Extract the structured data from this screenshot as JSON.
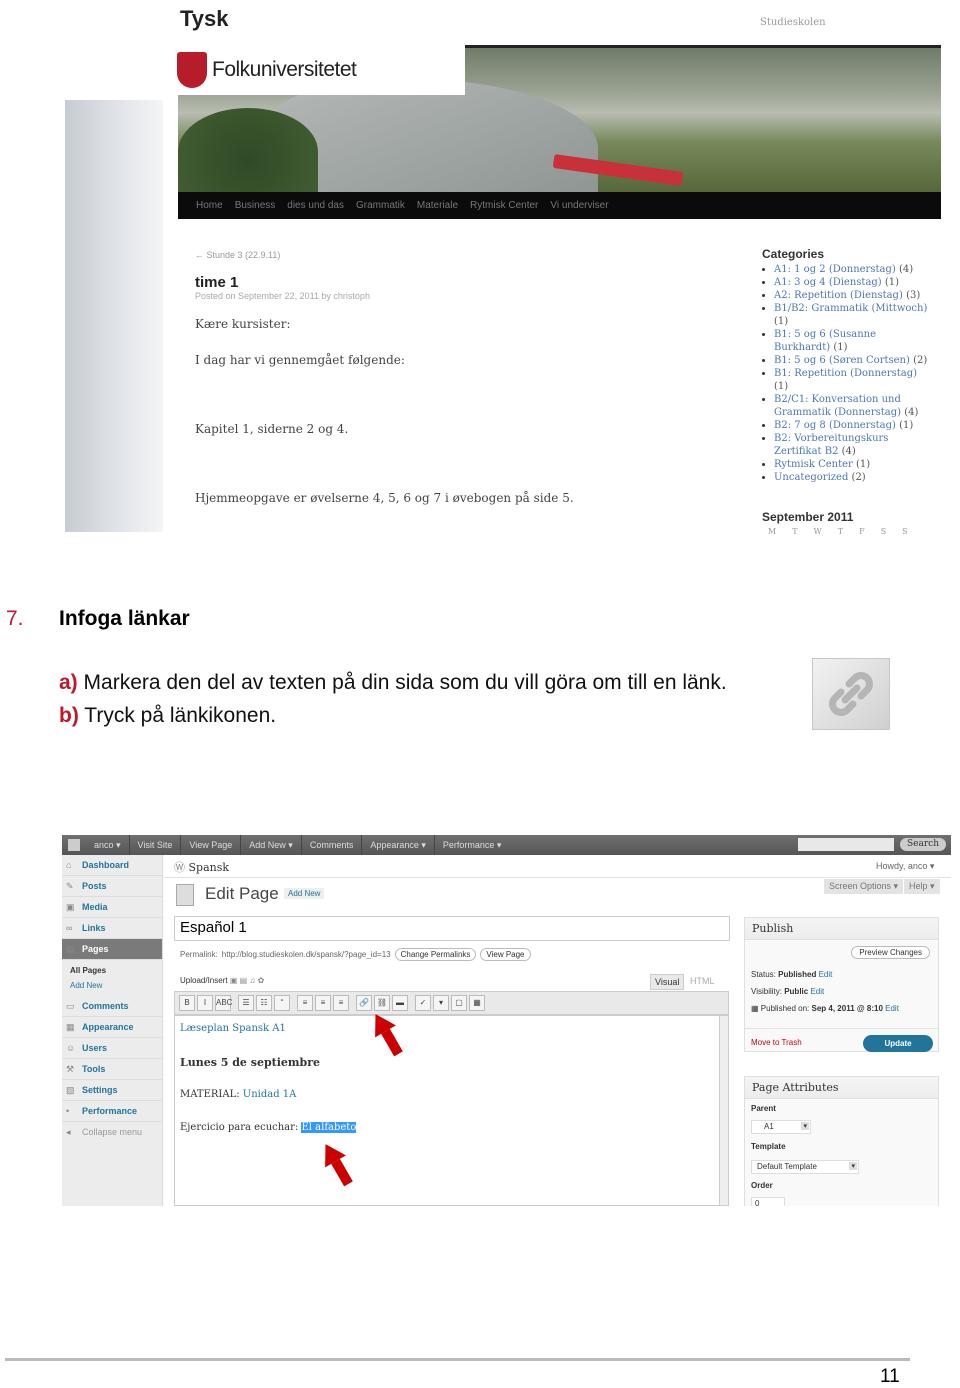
{
  "site_screenshot": {
    "site_title": "Tysk",
    "tagline": "Studieskolen",
    "logo_text": "Folkuniversitetet",
    "nav": [
      "Home",
      "Business",
      "dies und das",
      "Grammatik",
      "Materiale",
      "Rytmisk Center",
      "Vi underviser"
    ],
    "post": {
      "prev_link": "← Stunde 3 (22.9.11)",
      "title": "time 1",
      "meta": "Posted on September 22, 2011 by christoph",
      "paragraphs": [
        "Kære kursister:",
        "I dag har vi gennemgået følgende:",
        "Kapitel 1, siderne 2 og 4.",
        "Hjemmeopgave er øvelserne 4, 5, 6 og 7 i øvebogen på side 5."
      ]
    },
    "categories_title": "Categories",
    "categories": [
      {
        "name": "A1: 1 og 2 (Donnerstag)",
        "count": "(4)"
      },
      {
        "name": "A1: 3 og 4 (Dienstag)",
        "count": "(1)"
      },
      {
        "name": "A2: Repetition (Dienstag)",
        "count": "(3)"
      },
      {
        "name": "B1/B2: Grammatik (Mittwoch)",
        "count": "(1)"
      },
      {
        "name": "B1: 5 og 6 (Susanne Burkhardt)",
        "count": "(1)"
      },
      {
        "name": "B1: 5 og 6 (Søren Cortsen)",
        "count": "(2)"
      },
      {
        "name": "B1: Repetition (Donnerstag)",
        "count": "(1)"
      },
      {
        "name": "B2/C1: Konversation und Grammatik (Donnerstag)",
        "count": "(4)"
      },
      {
        "name": "B2: 7 og 8 (Donnerstag)",
        "count": "(1)"
      },
      {
        "name": "B2: Vorbereitungskurs Zertifikat B2",
        "count": "(4)"
      },
      {
        "name": "Rytmisk Center",
        "count": "(1)"
      },
      {
        "name": "Uncategorized",
        "count": "(2)"
      }
    ],
    "calendar_title": "September 2011",
    "weekdays": [
      "M",
      "T",
      "W",
      "T",
      "F",
      "S",
      "S"
    ]
  },
  "section": {
    "number": "7.",
    "title": "Infoga länkar",
    "steps": [
      {
        "label": "a)",
        "text": " Markera den del av texten på din sida som du vill göra om till en länk."
      },
      {
        "label": "b)",
        "text": " Tryck på länkikonen."
      }
    ],
    "link_icon": "link-icon"
  },
  "wp": {
    "admin_bar": [
      "anco ▾",
      "Visit Site",
      "View Page",
      "Add New ▾",
      "Comments",
      "Appearance ▾",
      "Performance ▾"
    ],
    "search_button": "Search",
    "site_name": "Spansk",
    "howdy": "Howdy, anco ▾",
    "screen_options": "Screen Options ▾",
    "help": "Help ▾",
    "menu": [
      {
        "label": "Dashboard",
        "icon": "⌂"
      },
      {
        "label": "Posts",
        "icon": "✎"
      },
      {
        "label": "Media",
        "icon": "▣"
      },
      {
        "label": "Links",
        "icon": "∞"
      },
      {
        "label": "Pages",
        "icon": "▤"
      },
      {
        "label": "Comments",
        "icon": "▭"
      },
      {
        "label": "Appearance",
        "icon": "▦"
      },
      {
        "label": "Users",
        "icon": "☺"
      },
      {
        "label": "Tools",
        "icon": "⚒"
      },
      {
        "label": "Settings",
        "icon": "▧"
      },
      {
        "label": "Performance",
        "icon": "•"
      },
      {
        "label": "Collapse menu",
        "icon": "◂"
      }
    ],
    "pages_sub": [
      "All Pages",
      "Add New"
    ],
    "heading": "Edit Page",
    "add_new": "Add New",
    "page_title_value": "Español 1",
    "permalink_label": "Permalink:",
    "permalink": "http://blog.studieskolen.dk/spansk/?page_id=13",
    "change_permalinks": "Change Permalinks",
    "view_page": "View Page",
    "upload_insert": "Upload/Insert",
    "tab_visual": "Visual",
    "tab_html": "HTML",
    "toolbar": [
      "B",
      "I",
      "ABC",
      "☰",
      "☷",
      "“",
      "≡",
      "≡",
      "≡",
      "🔗",
      "⛓",
      "▬",
      "✓",
      "▾",
      "▢",
      "▦"
    ],
    "content": {
      "link1": "Læseplan Spansk A1",
      "heading": "Lunes 5 de septiembre",
      "material_label": "MATERIAL: ",
      "material_link": "Unidad 1A",
      "exercise_label": "Ejercicio para ecuchar: ",
      "selected": "El alfabeto"
    },
    "publish": {
      "title": "Publish",
      "preview": "Preview Changes",
      "status_label": "Status: ",
      "status": "Published",
      "visibility_label": "Visibility: ",
      "visibility": "Public",
      "published_label": "Published on: ",
      "published": "Sep 4, 2011 @ 8:10",
      "edit": "Edit",
      "trash": "Move to Trash",
      "update": "Update"
    },
    "attributes": {
      "title": "Page Attributes",
      "parent_label": "Parent",
      "parent": "A1",
      "template_label": "Template",
      "template": "Default Template",
      "order_label": "Order",
      "order": "0"
    }
  },
  "page_number": "11"
}
